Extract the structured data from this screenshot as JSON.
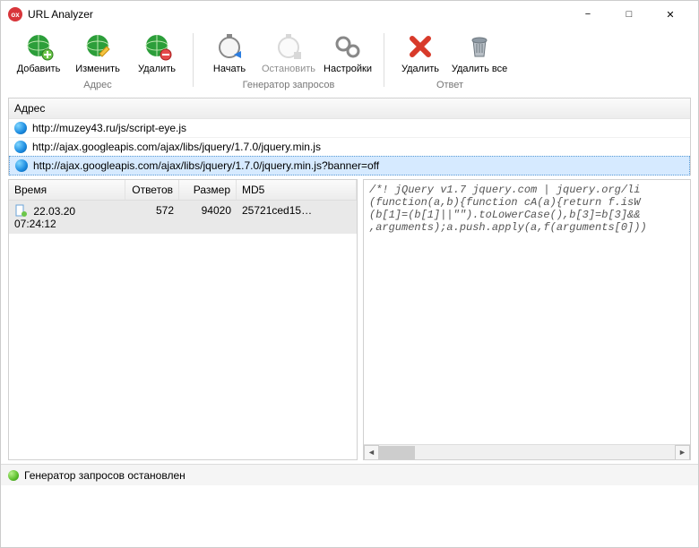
{
  "window": {
    "title": "URL Analyzer",
    "icon_text": "ox"
  },
  "toolbar": {
    "groups": {
      "address": {
        "label": "Адрес",
        "add": "Добавить",
        "edit": "Изменить",
        "delete": "Удалить"
      },
      "generator": {
        "label": "Генератор запросов",
        "start": "Начать",
        "stop": "Остановить",
        "stop_enabled": false,
        "settings": "Настройки"
      },
      "response": {
        "label": "Ответ",
        "delete": "Удалить",
        "delete_all": "Удалить все"
      }
    }
  },
  "address": {
    "header": "Адрес",
    "items": [
      {
        "url": "http://muzey43.ru/js/script-eye.js",
        "selected": false
      },
      {
        "url": "http://ajax.googleapis.com/ajax/libs/jquery/1.7.0/jquery.min.js",
        "selected": false
      },
      {
        "url": "http://ajax.googleapis.com/ajax/libs/jquery/1.7.0/jquery.min.js?banner=off",
        "selected": true
      }
    ]
  },
  "responses": {
    "columns": {
      "time": "Время",
      "answers": "Ответов",
      "size": "Размер",
      "md5": "MD5"
    },
    "rows": [
      {
        "time": "22.03.20 07:24:12",
        "answers": "572",
        "size": "94020",
        "md5": "25721ced15…",
        "selected": true
      }
    ]
  },
  "preview": {
    "line1": "/*! jQuery v1.7 jquery.com | jquery.org/li",
    "line2": "(function(a,b){function cA(a){return f.isW",
    "line3": "(b[1]=(b[1]||\"\").toLowerCase(),b[3]=b[3]&&",
    "line4": ",arguments);a.push.apply(a,f(arguments[0]))"
  },
  "statusbar": {
    "text": "Генератор запросов остановлен"
  }
}
